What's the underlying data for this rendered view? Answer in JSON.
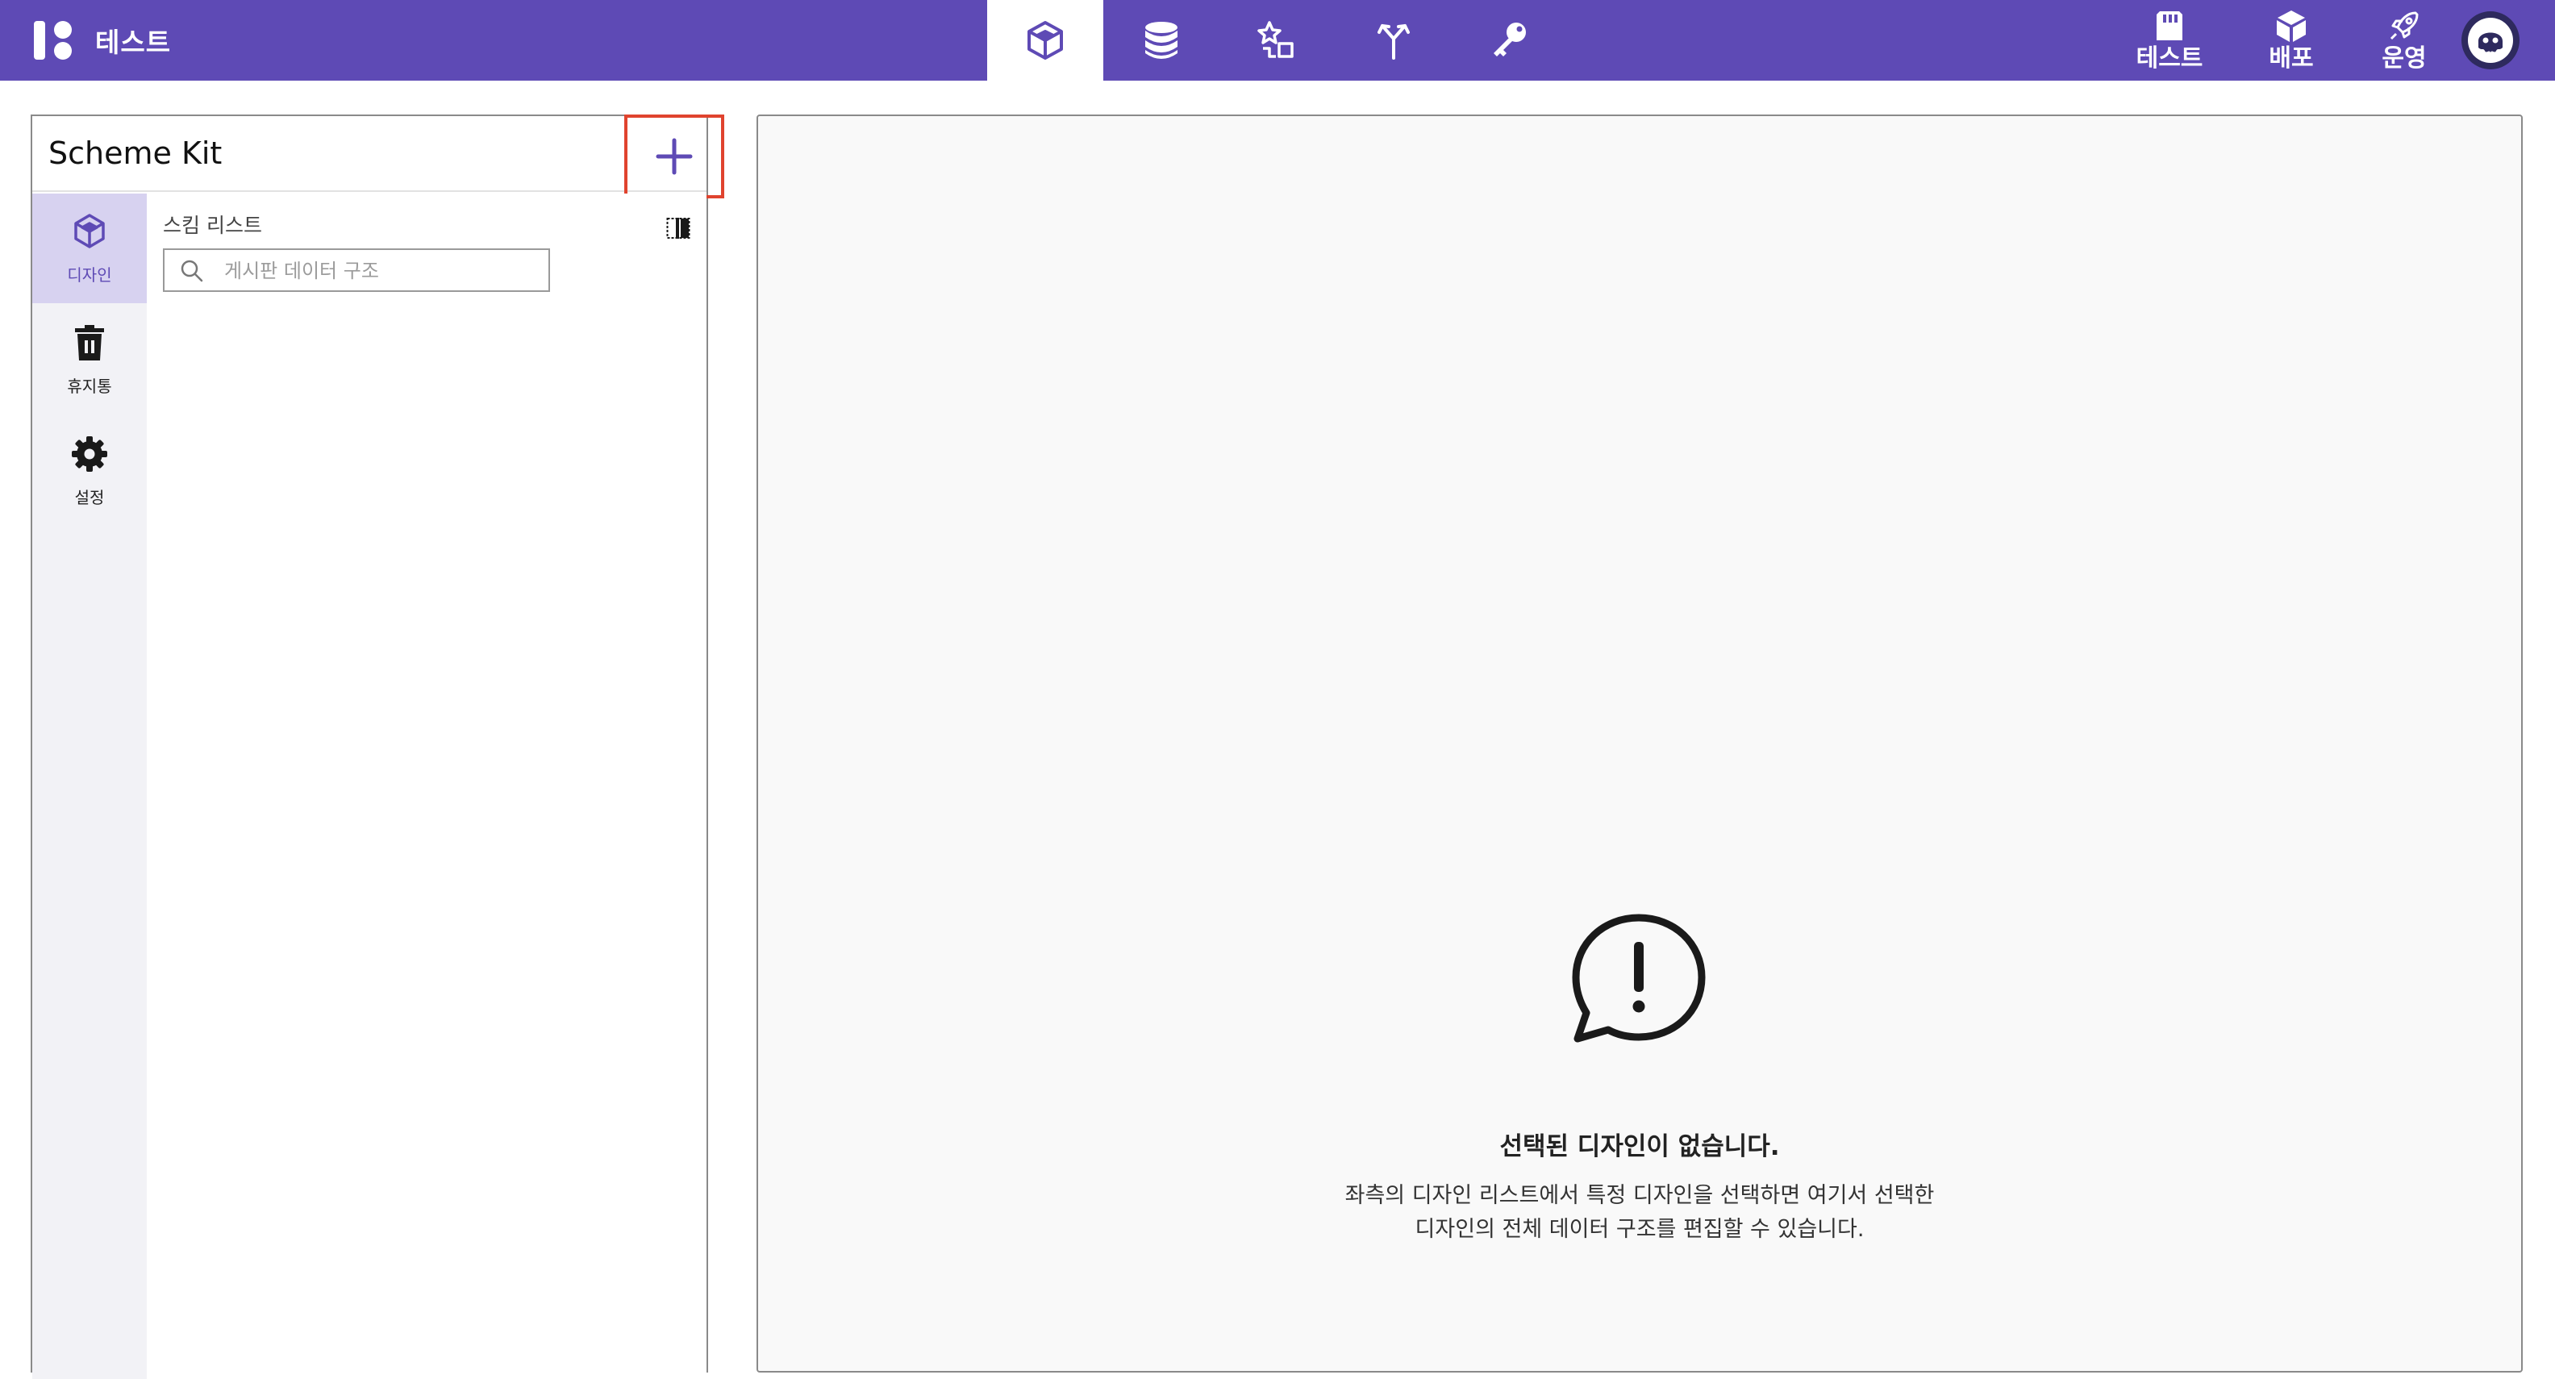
{
  "app": {
    "name": "테스트"
  },
  "colors": {
    "primary": "#5e4ab5",
    "highlight": "#e0432e",
    "rail_active": "#d7d2f0"
  },
  "top_nav": {
    "tabs": [
      {
        "icon": "cube-icon",
        "active": true
      },
      {
        "icon": "database-icon",
        "active": false
      },
      {
        "icon": "shapes-icon",
        "active": false
      },
      {
        "icon": "branch-icon",
        "active": false
      },
      {
        "icon": "key-icon",
        "active": false
      }
    ],
    "actions": [
      {
        "label": "테스트",
        "icon": "sd-card-icon"
      },
      {
        "label": "배포",
        "icon": "box-icon"
      },
      {
        "label": "운영",
        "icon": "rocket-icon"
      }
    ],
    "avatar": "user-avatar"
  },
  "left_panel": {
    "title": "Scheme Kit",
    "add_button": "plus-icon",
    "rail": [
      {
        "label": "디자인",
        "icon": "cube-icon",
        "active": true
      },
      {
        "label": "휴지통",
        "icon": "trash-icon",
        "active": false
      },
      {
        "label": "설정",
        "icon": "gear-icon",
        "active": false
      }
    ],
    "list": {
      "title": "스킴 리스트",
      "search_placeholder": "게시판 데이터 구조",
      "search_value": ""
    }
  },
  "main": {
    "empty_title": "선택된 디자인이 없습니다.",
    "empty_desc_line1": "좌측의 디자인 리스트에서 특정 디자인을 선택하면 여기서 선택한",
    "empty_desc_line2": "디자인의 전체 데이터 구조를 편집할 수 있습니다."
  }
}
